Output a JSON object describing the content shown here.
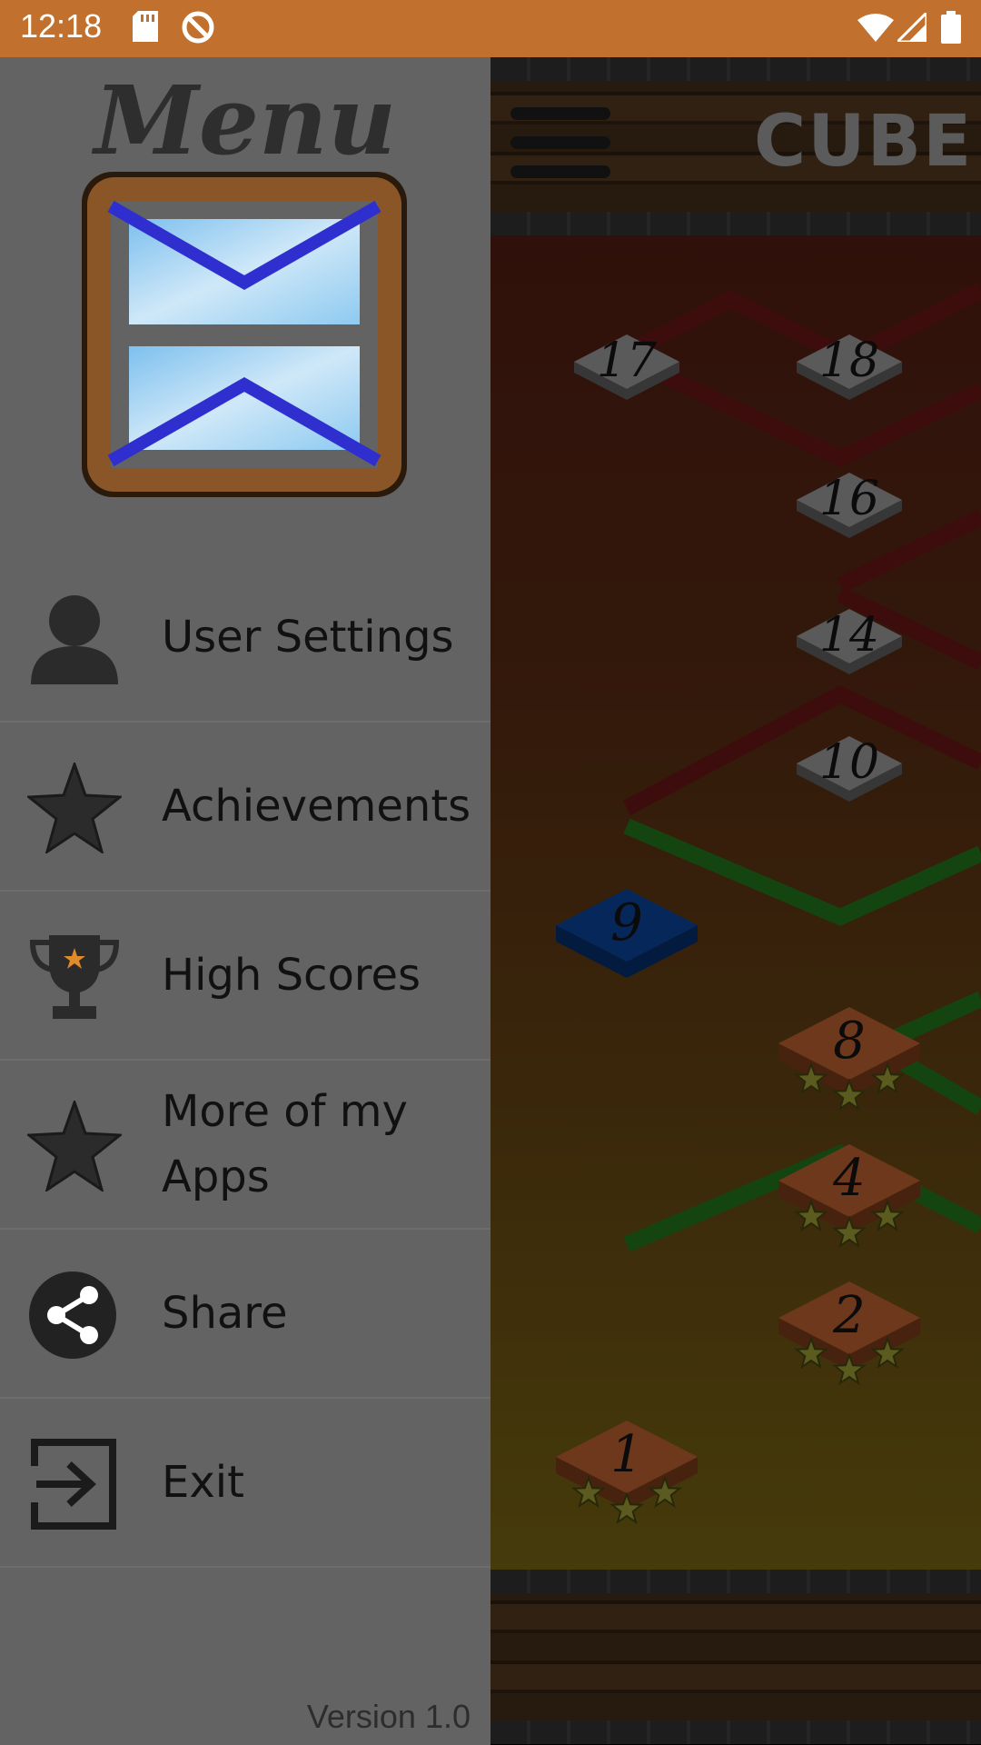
{
  "status_bar": {
    "time": "12:18"
  },
  "drawer": {
    "title": "Menu",
    "items": [
      {
        "label": "User Settings",
        "icon": "user-icon"
      },
      {
        "label": "Achievements",
        "icon": "star-icon"
      },
      {
        "label": "High Scores",
        "icon": "trophy-icon"
      },
      {
        "label": "More of my Apps",
        "icon": "star-icon"
      },
      {
        "label": "Share",
        "icon": "share-icon"
      },
      {
        "label": "Exit",
        "icon": "exit-icon"
      }
    ],
    "version": "Version 1.0"
  },
  "game": {
    "title": "CUBE",
    "levels": [
      {
        "label": "17",
        "state": "locked"
      },
      {
        "label": "18",
        "state": "locked"
      },
      {
        "label": "16",
        "state": "locked"
      },
      {
        "label": "14",
        "state": "locked"
      },
      {
        "label": "10",
        "state": "locked"
      },
      {
        "label": "9",
        "state": "current"
      },
      {
        "label": "8",
        "state": "completed"
      },
      {
        "label": "4",
        "state": "completed"
      },
      {
        "label": "2",
        "state": "completed"
      },
      {
        "label": "1",
        "state": "completed"
      }
    ]
  },
  "colors": {
    "status_bar": "#c1702e",
    "drawer_bg": "#636363",
    "current_level": "#0a3d8a",
    "completed_level": "#a8562a",
    "locked_level": "#8a8a8a"
  }
}
